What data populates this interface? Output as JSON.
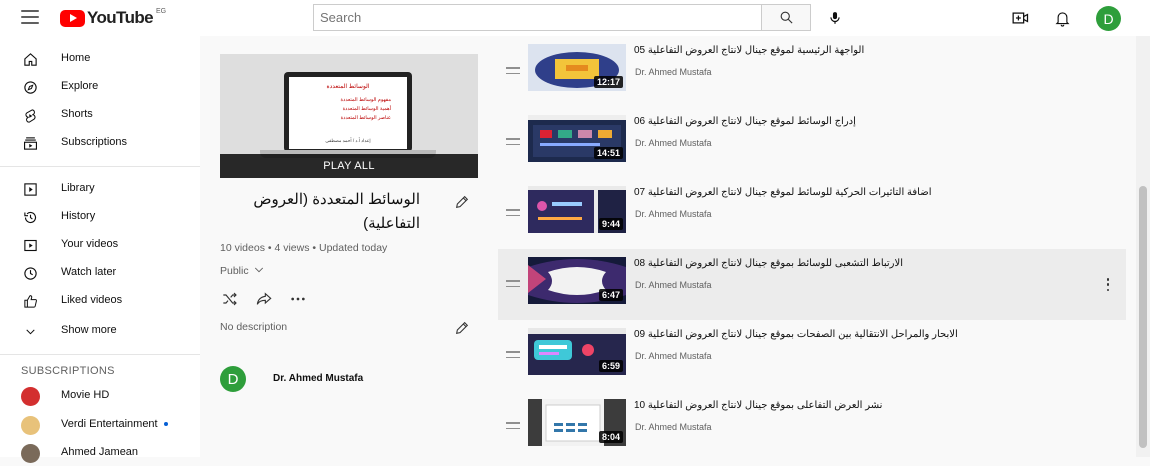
{
  "header": {
    "logo_text": "YouTube",
    "country": "EG",
    "search_placeholder": "Search",
    "avatar_letter": "D"
  },
  "sidebar": {
    "items": [
      {
        "label": "Home",
        "icon": "home-icon"
      },
      {
        "label": "Explore",
        "icon": "compass-icon"
      },
      {
        "label": "Shorts",
        "icon": "shorts-icon"
      },
      {
        "label": "Subscriptions",
        "icon": "subscriptions-icon"
      },
      {
        "label": "Library",
        "icon": "library-icon"
      },
      {
        "label": "History",
        "icon": "history-icon"
      },
      {
        "label": "Your videos",
        "icon": "your-videos-icon"
      },
      {
        "label": "Watch later",
        "icon": "clock-icon"
      },
      {
        "label": "Liked videos",
        "icon": "thumbs-up-icon"
      },
      {
        "label": "Show more",
        "icon": "chevron-down-icon"
      }
    ],
    "subscriptions_heading": "SUBSCRIPTIONS",
    "subscriptions": [
      {
        "label": "Movie HD",
        "color": "#d32f2f",
        "badge": ""
      },
      {
        "label": "Verdi Entertainment",
        "color": "#e8c27a",
        "badge": "new"
      },
      {
        "label": "Ahmed Jamean",
        "color": "#7a6a5a",
        "badge": ""
      }
    ]
  },
  "playlist": {
    "thumb_title": "الوسائط المتعددة",
    "thumb_lines": [
      "مفهوم الوسائط المتعددة",
      "أهمية الوسائط المتعددة",
      "عناصر الوسائط المتعددة"
    ],
    "thumb_footer": "إعداد أ.د / أحمد مصطفى",
    "play_all": "PLAY ALL",
    "title": "الوسائط المتعددة (العروض التفاعلية)",
    "meta": "10 videos • 4 views • Updated today",
    "privacy": "Public",
    "description": "No description",
    "owner_letter": "D",
    "owner_name": "Dr. Ahmed Mustafa"
  },
  "videos": [
    {
      "title": "الواجهة الرئيسية لموقع جينال لانتاج العروض التفاعلية 05",
      "channel": "Dr. Ahmed Mustafa",
      "duration": "12:17",
      "highlighted": false
    },
    {
      "title": "إدراج الوسائط لموقع جينال لانتاج العروض التفاعلية 06",
      "channel": "Dr. Ahmed Mustafa",
      "duration": "14:51",
      "highlighted": false
    },
    {
      "title": "اضافة التاثيرات الحركية للوسائط لموقع جينال لانتاج العروض التفاعلية 07",
      "channel": "Dr. Ahmed Mustafa",
      "duration": "9:44",
      "highlighted": false
    },
    {
      "title": "الارتباط التشعبى للوسائط بموقع جينال لانتاج العروض التفاعلية 08",
      "channel": "Dr. Ahmed Mustafa",
      "duration": "6:47",
      "highlighted": true
    },
    {
      "title": "الابحار والمراحل الانتقالية بين الصفحات بموقع جينال لانتاج العروض التفاعلية 09",
      "channel": "Dr. Ahmed Mustafa",
      "duration": "6:59",
      "highlighted": false
    },
    {
      "title": "نشر العرض التفاعلى بموقع جينال لانتاج العروض التفاعلية 10",
      "channel": "Dr. Ahmed Mustafa",
      "duration": "8:04",
      "highlighted": false
    }
  ]
}
